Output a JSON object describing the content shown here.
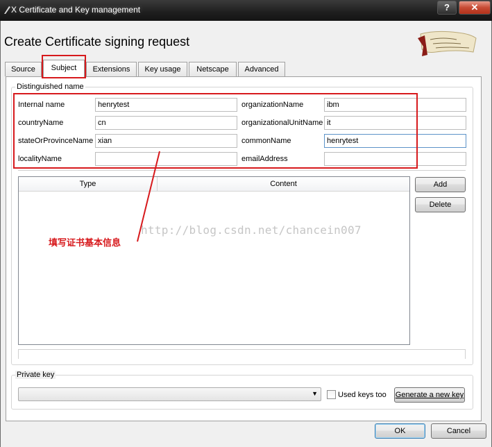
{
  "window": {
    "title": "X Certificate and Key management",
    "help_label": "?",
    "close_label": "✕"
  },
  "heading": "Create Certificate signing request",
  "tabs": [
    {
      "label": "Source"
    },
    {
      "label": "Subject"
    },
    {
      "label": "Extensions"
    },
    {
      "label": "Key usage"
    },
    {
      "label": "Netscape"
    },
    {
      "label": "Advanced"
    }
  ],
  "distinguished_name": {
    "group_label": "Distinguished name",
    "fields": {
      "internal_name": {
        "label": "Internal name",
        "value": "henrytest"
      },
      "country_name": {
        "label": "countryName",
        "value": "cn"
      },
      "state_or_province_name": {
        "label": "stateOrProvinceName",
        "value": "xian"
      },
      "locality_name": {
        "label": "localityName",
        "value": ""
      },
      "organization_name": {
        "label": "organizationName",
        "value": "ibm"
      },
      "organizational_unit_name": {
        "label": "organizationalUnitName",
        "value": "it"
      },
      "common_name": {
        "label": "commonName",
        "value": "henrytest"
      },
      "email_address": {
        "label": "emailAddress",
        "value": ""
      }
    }
  },
  "table": {
    "columns": [
      "Type",
      "Content"
    ]
  },
  "buttons": {
    "add": "Add",
    "delete": "Delete",
    "generate_key": "Generate a new key",
    "ok": "OK",
    "cancel": "Cancel"
  },
  "private_key": {
    "group_label": "Private key",
    "selected": "",
    "used_keys_too_label": "Used keys too",
    "used_keys_too_checked": false
  },
  "annotation": {
    "text": "填写证书基本信息",
    "color": "#d7191c"
  },
  "watermark": "http://blog.csdn.net/chancein007"
}
